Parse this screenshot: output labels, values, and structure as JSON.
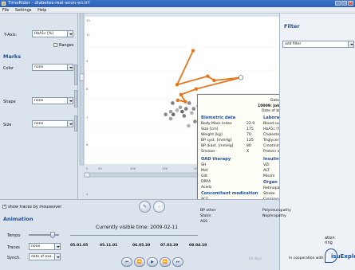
{
  "window": {
    "title": "TimeRider - diabetes-real-anon-en.trf",
    "min": "_",
    "max": "□",
    "close": "x"
  },
  "menu": [
    "File",
    "Settings",
    "Help"
  ],
  "left": {
    "yaxis_label": "Y-Axis:",
    "yaxis_value": "HbA1c [%]",
    "ranges_label": "Ranges",
    "marks_title": "Marks",
    "color_label": "Color",
    "color_value": "none",
    "shape_label": "Shape",
    "shape_value": "none",
    "size_label": "Size",
    "size_value": "none"
  },
  "plot": {
    "y_ticks": [
      "10",
      "11",
      "9",
      "8",
      "7",
      "6",
      "5",
      "4"
    ],
    "x_ticks": [
      "50",
      "100",
      "150",
      "200",
      "250",
      "300"
    ]
  },
  "chart_data": {
    "type": "scatter",
    "ylabel": "HbA1c [%]",
    "selected_trace": {
      "points": [
        [
          195,
          10.5
        ],
        [
          170,
          8.1
        ],
        [
          218,
          8.7
        ],
        [
          228,
          8.4
        ],
        [
          270,
          8.6
        ],
        [
          200,
          7.8
        ],
        [
          176,
          7.4
        ],
        [
          183,
          6.9
        ],
        [
          171,
          7.0
        ]
      ],
      "color": "#e8751a"
    },
    "background_points": [
      [
        163,
        6.8
      ],
      [
        175,
        6.5
      ],
      [
        189,
        6.8
      ],
      [
        203,
        6.6
      ],
      [
        212,
        6.6
      ],
      [
        230,
        6.6
      ],
      [
        238,
        6.6
      ],
      [
        196,
        6.4
      ],
      [
        170,
        6.3
      ],
      [
        178,
        6.2
      ],
      [
        184,
        6.4
      ],
      [
        160,
        6.2
      ],
      [
        152,
        6.0
      ],
      [
        193,
        6.1
      ],
      [
        164,
        6.0
      ],
      [
        181,
        5.9
      ],
      [
        160,
        5.7
      ],
      [
        198,
        5.5
      ],
      [
        188,
        5.2
      ]
    ]
  },
  "tooltip": {
    "date_label": "Date:",
    "date_value": "2009-01-28",
    "patient": "10009: John Doe,",
    "gender": "male",
    "dob_label": "Date of birth:",
    "dob_value": "1966-01-01",
    "bio_title": "Biometric data",
    "bio": [
      {
        "k": "Body Mass Index",
        "v": "22.9"
      },
      {
        "k": "Size [cm]",
        "v": "175"
      },
      {
        "k": "Weight [kg]",
        "v": "70"
      },
      {
        "k": "BP syst. [mmHg]",
        "v": "125"
      },
      {
        "k": "BP diast. [mmHg]",
        "v": "80"
      },
      {
        "k": "Smoker",
        "v": "X"
      }
    ],
    "lab_title": "Laboratory",
    "lab": [
      {
        "k": "Blood sugar [mg/dl]",
        "v": "246"
      },
      {
        "k": "HbA1c [%]",
        "v": "10"
      },
      {
        "k": "Cholesterol [mg/dl]",
        "v": "163"
      },
      {
        "k": "Triglyceride [mg/dl]",
        "v": "72"
      },
      {
        "k": "Creatinine [mg/dl]",
        "v": "0.8"
      },
      {
        "k": "Protein in urine",
        "v": ""
      }
    ],
    "oad_title": "OAD therapy",
    "oad": [
      "SH",
      "Met",
      "Glit",
      "DPP4",
      "Acarb"
    ],
    "ins_title": "Insulin therapy",
    "ins": [
      {
        "k": "VZI",
        "v": ""
      },
      {
        "k": "ALT",
        "v": ""
      },
      {
        "k": "Mischl",
        "v": "X"
      }
    ],
    "organ_title": "Organ Damages",
    "organ": [
      "Retinopathy",
      "Stroke",
      "Coronary Heart D.",
      "PAOD",
      "Polyneuropathy",
      "Nephropathy"
    ],
    "conc_title": "Concomitant medication",
    "conc": [
      "ACE",
      "Bbl",
      "BP other",
      "Statin",
      "ASS"
    ]
  },
  "right": {
    "filter_title": "Filter",
    "filter_value": "add filter",
    "peek_1": "ation",
    "peek_2": "ring",
    "coop": "In cooperation with",
    "logo": "isuExplore"
  },
  "animation": {
    "show_traces": "show traces by mouseover",
    "title": "Animation",
    "visible_time": "Currently visible time: 2009-02-11",
    "tempo_label": "Tempo",
    "traces_label": "Traces",
    "traces_value": "none",
    "synch_label": "Synch.",
    "synch_value": "date of exa...",
    "dates": [
      "05.01.05",
      "05.11.01",
      "06.05.20",
      "07.03.29",
      "08.04.19"
    ],
    "ghost_1": "60 days"
  }
}
